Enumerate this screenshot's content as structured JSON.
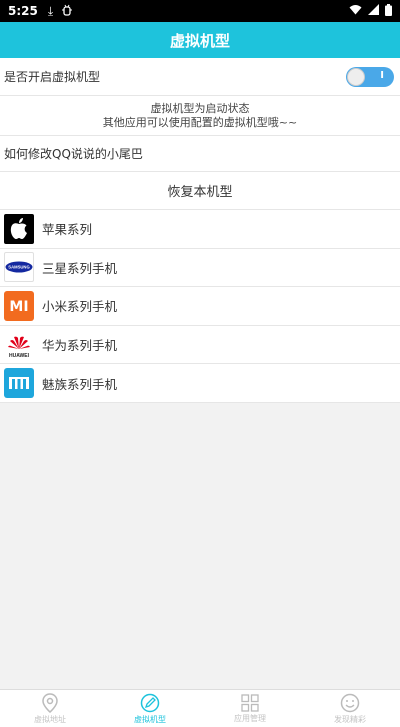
{
  "status_bar": {
    "time": "5:25"
  },
  "app_bar": {
    "title": "虚拟机型"
  },
  "virtual_toggle": {
    "label": "是否开启虚拟机型",
    "state_text": "I"
  },
  "status_message": {
    "line1": "虚拟机型为启动状态",
    "line2": "其他应用可以使用配置的虚拟机型哦~~"
  },
  "modify_link": {
    "label": "如何修改QQ说说的小尾巴"
  },
  "restore": {
    "label": "恢复本机型"
  },
  "brands": [
    {
      "label": "苹果系列",
      "icon": "apple-icon"
    },
    {
      "label": "三星系列手机",
      "icon": "samsung-icon",
      "logo_text": "SAMSUNG"
    },
    {
      "label": "小米系列手机",
      "icon": "xiaomi-icon",
      "logo_text": "MI"
    },
    {
      "label": "华为系列手机",
      "icon": "huawei-icon",
      "logo_text": "HUAWEI"
    },
    {
      "label": "魅族系列手机",
      "icon": "meizu-icon"
    }
  ],
  "tabs": [
    {
      "label": "虚拟地址",
      "icon": "location-pin-icon",
      "active": false
    },
    {
      "label": "虚拟机型",
      "icon": "edit-pen-icon",
      "active": true
    },
    {
      "label": "应用管理",
      "icon": "grid-apps-icon",
      "active": false
    },
    {
      "label": "发现精彩",
      "icon": "smile-icon",
      "active": false
    }
  ],
  "colors": {
    "accent": "#1ec3dc",
    "toggle_on": "#4aa8e8",
    "xiaomi": "#f26b1f",
    "meizu": "#1ea6dc",
    "huawei": "#e1001a"
  }
}
